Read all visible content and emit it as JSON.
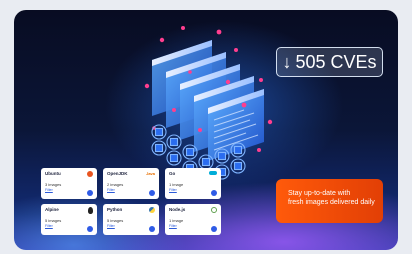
{
  "badge": {
    "arrow": "↓",
    "label": "505 CVEs"
  },
  "promo": {
    "line1": "Stay up-to-date with",
    "line2": "fresh images delivered daily"
  },
  "tiles": [
    {
      "name": "Ubuntu",
      "count": "3 images",
      "link": "Filter",
      "logo_color": "#e95420"
    },
    {
      "name": "OpenJDK",
      "count": "2 images",
      "link": "Filter",
      "logo_color": "#e76f00",
      "logo_text": "Java"
    },
    {
      "name": "Go",
      "count": "1 image",
      "link": "Filter",
      "logo_color": "#00add8"
    },
    {
      "name": "Alpine",
      "count": "5 images",
      "link": "Filter",
      "logo_color": "#222222"
    },
    {
      "name": "Python",
      "count": "5 images",
      "link": "Filter",
      "logo_color": "#3776ab"
    },
    {
      "name": "Node.js",
      "count": "1 image",
      "link": "Filter",
      "logo_color": "#5fa04e"
    }
  ],
  "colors": {
    "accent_orange": "#ff5a0a",
    "background_dark": "#080c22",
    "card_link": "#2c5bd8"
  }
}
